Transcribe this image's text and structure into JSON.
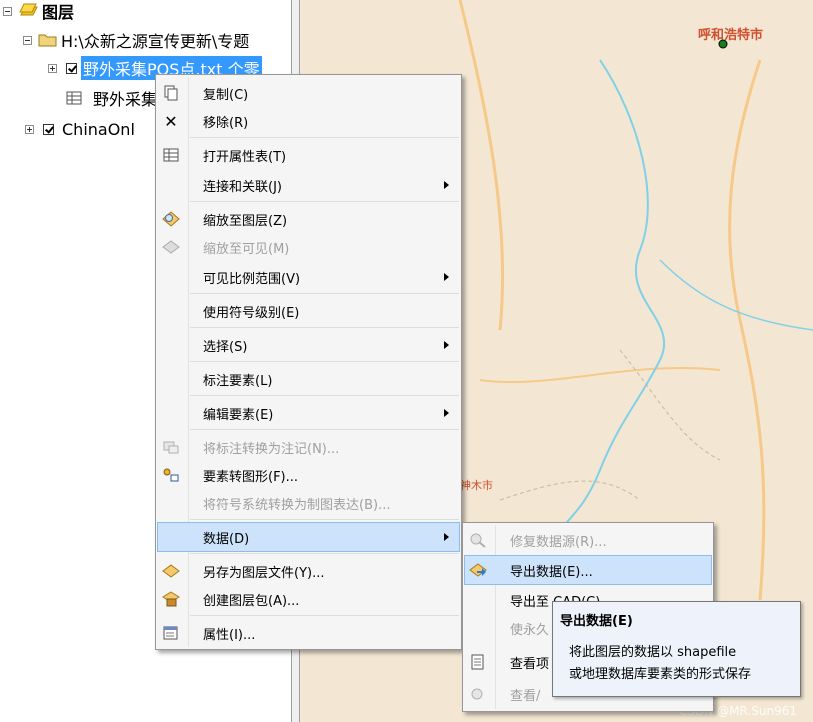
{
  "toc": {
    "root_label": "图层",
    "group_label": "H:\\众新之源宣传更新\\专题",
    "layer_selected": "野外采集POS点.txt 个零",
    "table_label": "野外采集",
    "basemap_label": "ChinaOnl"
  },
  "map": {
    "city_1": "呼和浩特市",
    "city_2": "神木市",
    "colors": {
      "land": "#f3e7d3",
      "river": "#7fd0e8",
      "road": "#f6c98a",
      "border": "#c8b79a"
    }
  },
  "context_menu": {
    "items": [
      {
        "label": "复制(C)",
        "icon": "copy-icon",
        "enabled": true
      },
      {
        "label": "移除(R)",
        "icon": "remove-icon",
        "enabled": true
      },
      {
        "label": "打开属性表(T)",
        "icon": "table-icon",
        "enabled": true
      },
      {
        "label": "连接和关联(J)",
        "icon": "",
        "enabled": true,
        "submenu": true
      },
      {
        "label": "缩放至图层(Z)",
        "icon": "zoom-layer-icon",
        "enabled": true
      },
      {
        "label": "缩放至可见(M)",
        "icon": "zoom-visible-icon",
        "enabled": false
      },
      {
        "label": "可见比例范围(V)",
        "icon": "",
        "enabled": true,
        "submenu": true
      },
      {
        "label": "使用符号级别(E)",
        "icon": "",
        "enabled": true
      },
      {
        "label": "选择(S)",
        "icon": "",
        "enabled": true,
        "submenu": true
      },
      {
        "label": "标注要素(L)",
        "icon": "",
        "enabled": true
      },
      {
        "label": "编辑要素(E)",
        "icon": "",
        "enabled": true,
        "submenu": true
      },
      {
        "label": "将标注转换为注记(N)...",
        "icon": "convert-labels-icon",
        "enabled": false
      },
      {
        "label": "要素转图形(F)...",
        "icon": "features-to-graphics-icon",
        "enabled": true
      },
      {
        "label": "将符号系统转换为制图表达(B)...",
        "icon": "",
        "enabled": false
      },
      {
        "label": "数据(D)",
        "icon": "",
        "enabled": true,
        "submenu": true,
        "highlighted": true
      },
      {
        "label": "另存为图层文件(Y)...",
        "icon": "layer-file-icon",
        "enabled": true
      },
      {
        "label": "创建图层包(A)...",
        "icon": "layer-package-icon",
        "enabled": true
      },
      {
        "label": "属性(I)...",
        "icon": "properties-icon",
        "enabled": true
      }
    ]
  },
  "data_submenu": {
    "items": [
      {
        "label": "修复数据源(R)...",
        "icon": "repair-icon",
        "enabled": false
      },
      {
        "label": "导出数据(E)...",
        "icon": "export-data-icon",
        "enabled": true,
        "highlighted": true
      },
      {
        "label": "导出至 CAD(C)...",
        "icon": "",
        "enabled": true
      },
      {
        "label": "使永久",
        "icon": "",
        "enabled": false
      },
      {
        "label": "查看项",
        "icon": "view-item-icon",
        "enabled": true
      },
      {
        "label": "查看/",
        "icon": "view-icon",
        "enabled": false
      }
    ]
  },
  "tooltip": {
    "title": "导出数据(E)",
    "line1": "将此图层的数据以 shapefile",
    "line2": "或地理数据库要素类的形式保存"
  },
  "watermark": "CSDN @MR.Sun961"
}
